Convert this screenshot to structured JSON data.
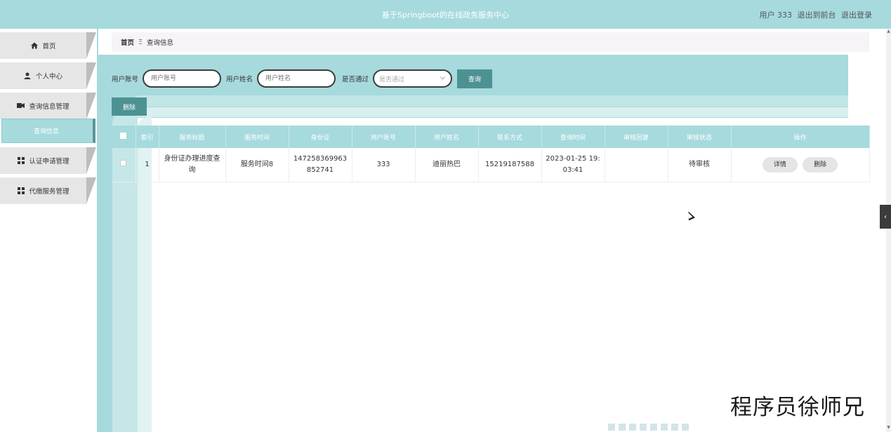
{
  "header": {
    "title": "基于Springboot的在线政务服务中心",
    "user_label": "用户 333",
    "back_to_front": "退出到前台",
    "logout": "退出登录"
  },
  "sidebar": {
    "items": [
      {
        "label": "首页",
        "icon": "home-icon"
      },
      {
        "label": "个人中心",
        "icon": "user-icon"
      },
      {
        "label": "查询信息管理",
        "icon": "film-icon"
      },
      {
        "label": "认证申请管理",
        "icon": "grid-icon"
      },
      {
        "label": "代缴服务管理",
        "icon": "grid-icon"
      }
    ],
    "sub_item": "查询信息"
  },
  "breadcrumb": {
    "home": "首页",
    "separator": "Ξ",
    "current": "查询信息"
  },
  "search": {
    "account_label": "用户账号",
    "account_placeholder": "用户账号",
    "name_label": "用户姓名",
    "name_placeholder": "用户姓名",
    "passed_label": "是否通过",
    "passed_placeholder": "是否通过",
    "query_button": "查询"
  },
  "actions": {
    "delete_button": "删除"
  },
  "table": {
    "headers": [
      "索引",
      "服务标题",
      "服务时间",
      "身份证",
      "用户账号",
      "用户姓名",
      "联系方式",
      "查询时间",
      "审核回复",
      "审核状态",
      "操作"
    ],
    "rows": [
      {
        "index": "1",
        "service_title": "身份证办理进度查询",
        "service_time": "服务时间8",
        "id_card": "147258369963852741",
        "account": "333",
        "name": "迪丽热巴",
        "phone": "15219187588",
        "query_time": "2023-01-25 19:03:41",
        "reply": "",
        "status": "待审核",
        "detail_btn": "详情",
        "delete_btn": "删除"
      }
    ]
  },
  "watermark": "程序员徐师兄",
  "colors": {
    "accent": "#a6dadd",
    "button": "#4d9293",
    "menu_bg": "#e6e6e6"
  }
}
